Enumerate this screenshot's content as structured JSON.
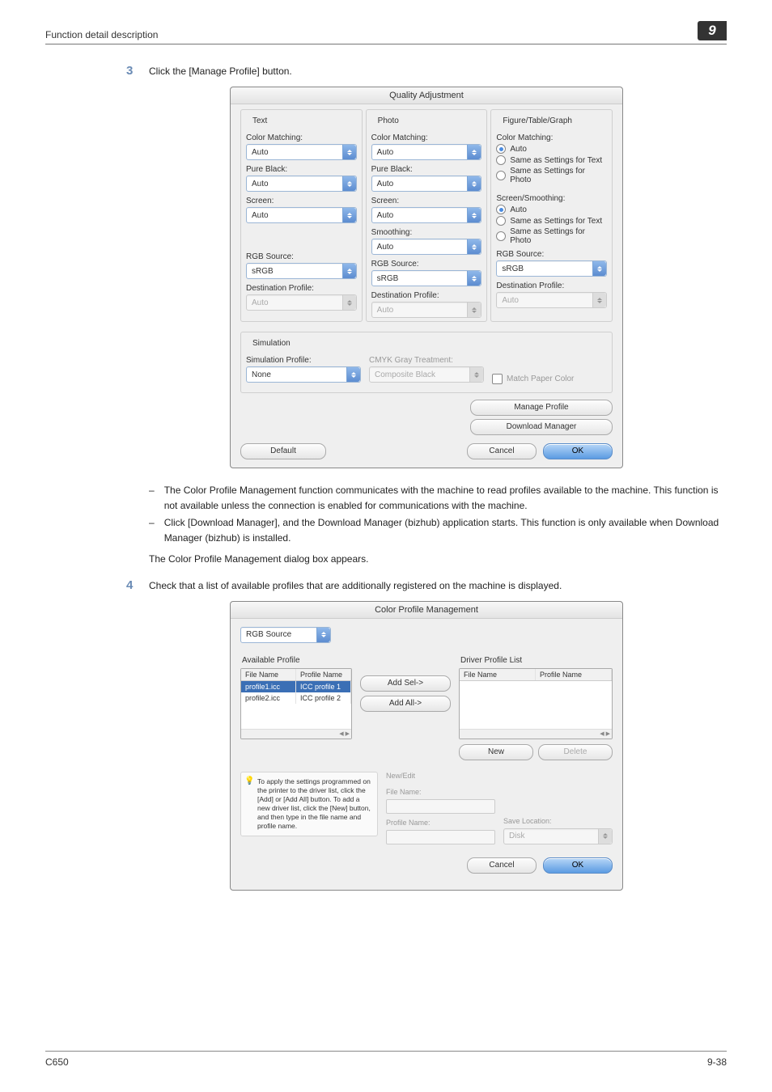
{
  "header": {
    "section_title": "Function detail description",
    "page_badge": "9"
  },
  "step3": {
    "num": "3",
    "text": "Click the [Manage Profile] button."
  },
  "quality_adjustment": {
    "title": "Quality Adjustment",
    "legends": {
      "text": "Text",
      "photo": "Photo",
      "ftg": "Figure/Table/Graph",
      "sim": "Simulation"
    },
    "labels": {
      "color_matching": "Color Matching:",
      "pure_black": "Pure Black:",
      "screen": "Screen:",
      "smoothing": "Smoothing:",
      "rgb_source": "RGB Source:",
      "dest_profile": "Destination Profile:",
      "screen_smoothing": "Screen/Smoothing:",
      "sim_profile": "Simulation Profile:",
      "cmyk_gray": "CMYK Gray Treatment:",
      "match_paper": "Match Paper Color"
    },
    "values": {
      "auto": "Auto",
      "srgb": "sRGB",
      "none": "None",
      "composite_black": "Composite Black"
    },
    "radios": {
      "auto": "Auto",
      "same_text": "Same as Settings for Text",
      "same_photo": "Same as Settings for Photo"
    },
    "buttons": {
      "manage_profile": "Manage Profile",
      "download_manager": "Download Manager",
      "default": "Default",
      "cancel": "Cancel",
      "ok": "OK"
    }
  },
  "bullets": {
    "b1": "The Color Profile Management function communicates with the machine to read profiles available to the machine. This function is not available unless the connection is enabled for communications with the machine.",
    "b2": "Click [Download Manager], and the Download Manager (bizhub) application starts. This function is only available when Download Manager (bizhub) is installed."
  },
  "plain_line": "The Color Profile Management dialog box appears.",
  "step4": {
    "num": "4",
    "text": "Check that a list of available profiles that are additionally registered on the machine is displayed."
  },
  "cpm": {
    "title": "Color Profile Management",
    "dropdown_label": "RGB Source",
    "available_label": "Available Profile",
    "driver_label": "Driver Profile List",
    "columns": {
      "file": "File Name",
      "profile": "Profile Name"
    },
    "rows": [
      {
        "file": "profile1.icc",
        "profile": "ICC profile 1"
      },
      {
        "file": "profile2.icc",
        "profile": "ICC profile 2"
      }
    ],
    "buttons": {
      "add_sel": "Add Sel->",
      "add_all": "Add All->",
      "new": "New",
      "delete": "Delete",
      "cancel": "Cancel",
      "ok": "OK"
    },
    "newedit": {
      "group": "New/Edit",
      "file_name": "File Name:",
      "profile_name": "Profile Name:",
      "save_location": "Save Location:",
      "disk": "Disk"
    },
    "tip": "To apply the settings programmed on the printer to the driver list, click the [Add] or [Add All] button. To add a new driver list, click the [New] button, and then type in the file name and profile name."
  },
  "footer": {
    "left": "C650",
    "right": "9-38"
  }
}
